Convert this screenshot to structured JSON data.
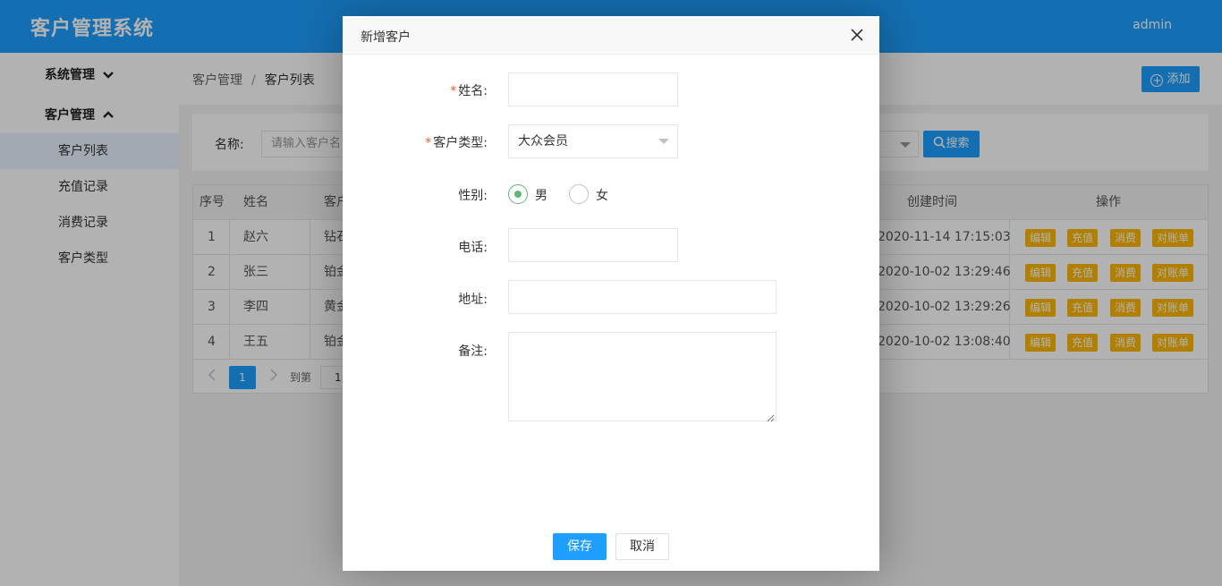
{
  "app": {
    "title": "客户管理系统",
    "user": "admin"
  },
  "sidebar": {
    "groups": [
      {
        "label": "系统管理",
        "chevron": "chevron-down-icon"
      },
      {
        "label": "客户管理",
        "chevron": "chevron-up-icon"
      }
    ],
    "items": [
      {
        "label": "客户列表",
        "active": true
      },
      {
        "label": "充值记录"
      },
      {
        "label": "消费记录"
      },
      {
        "label": "客户类型"
      }
    ]
  },
  "breadcrumb": {
    "first": "客户管理",
    "separator": "/",
    "current": "客户列表"
  },
  "toolbar": {
    "add_label": "添加"
  },
  "search": {
    "label": "名称:",
    "placeholder": "请输入客户名",
    "button_label": "搜索"
  },
  "table": {
    "headers": [
      "序号",
      "姓名",
      "客户",
      "创建时间",
      "操作"
    ],
    "rows": [
      {
        "no": "1",
        "name": "赵六",
        "type": "钻石",
        "created": "2020-11-14 17:15:03"
      },
      {
        "no": "2",
        "name": "张三",
        "type": "铂金",
        "created": "2020-10-02 13:29:46"
      },
      {
        "no": "3",
        "name": "李四",
        "type": "黄金",
        "created": "2020-10-02 13:29:26"
      },
      {
        "no": "4",
        "name": "王五",
        "type": "铂金",
        "created": "2020-10-02 13:08:40"
      }
    ],
    "actions": [
      "编辑",
      "充值",
      "消费",
      "对账单"
    ]
  },
  "pagination": {
    "current": "1",
    "goto_label": "到第",
    "goto_value": "1"
  },
  "modal": {
    "title": "新增客户",
    "fields": {
      "name": {
        "label": "姓名:",
        "required_mark": "*",
        "value": ""
      },
      "customer_type": {
        "label": "客户类型:",
        "required_mark": "*",
        "value": "大众会员"
      },
      "gender": {
        "label": "性别:",
        "options": [
          "男",
          "女"
        ],
        "selected": "男"
      },
      "phone": {
        "label": "电话:",
        "value": ""
      },
      "address": {
        "label": "地址:",
        "value": ""
      },
      "remark": {
        "label": "备注:",
        "value": ""
      }
    },
    "save_label": "保存",
    "cancel_label": "取消"
  },
  "colors": {
    "primary": "#1e9fff",
    "action": "#ffb800",
    "radio_checked": "#5fb878",
    "required": "#ff5722"
  }
}
